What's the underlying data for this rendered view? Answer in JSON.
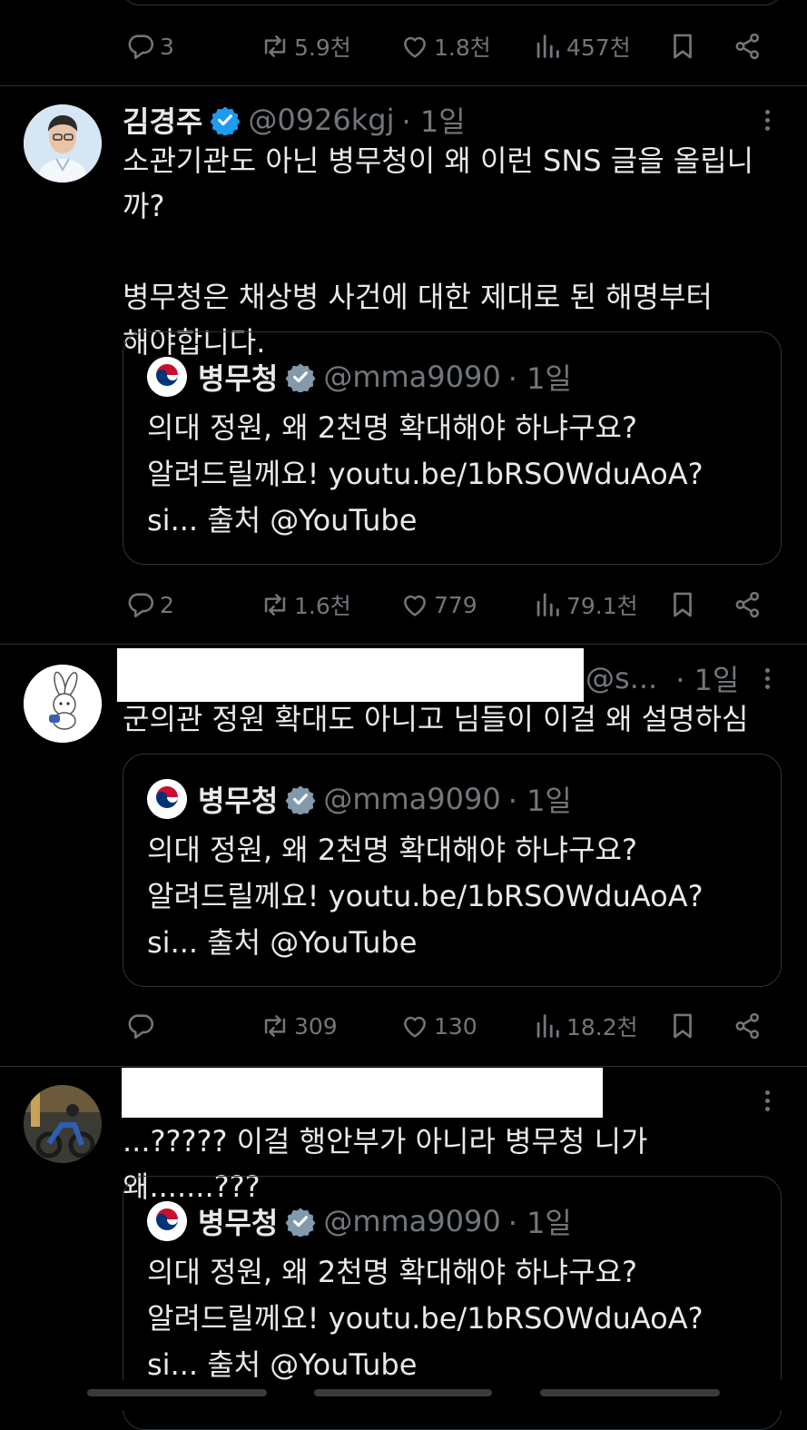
{
  "colors": {
    "background": "#000000",
    "text": "#e7e9ea",
    "muted": "#71767b",
    "verified": "#1d9bf0",
    "divider": "#2f3336"
  },
  "top_actions": {
    "replies": "3",
    "reposts": "5.9천",
    "likes": "1.8천",
    "views": "457천"
  },
  "posts": [
    {
      "name": "김경주",
      "handle": "@0926kgj",
      "time": "· 1일",
      "text": "소관기관도 아닌 병무청이 왜 이런 SNS 글을 올립니까?\n\n병무청은 채상병 사건에 대한 제대로 된 해명부터\n해야합니다.",
      "quote": {
        "name": "병무청",
        "handle": "@mma9090",
        "time": "· 1일",
        "text": "의대 정원, 왜 2천명 확대해야 하냐구요?\n알려드릴께요! youtu.be/1bRSOWduAoA?\nsi... 출처 @YouTube"
      },
      "actions": {
        "replies": "2",
        "reposts": "1.6천",
        "likes": "779",
        "views": "79.1천"
      }
    },
    {
      "handle": "@s...",
      "time": "· 1일",
      "text": "군의관 정원 확대도 아니고 님들이 이걸 왜 설명하심",
      "quote": {
        "name": "병무청",
        "handle": "@mma9090",
        "time": "· 1일",
        "text": "의대 정원, 왜 2천명 확대해야 하냐구요?\n알려드릴께요! youtu.be/1bRSOWduAoA?\nsi... 출처 @YouTube"
      },
      "actions": {
        "replies": "",
        "reposts": "309",
        "likes": "130",
        "views": "18.2천"
      }
    },
    {
      "text": "...????? 이걸 행안부가 아니라 병무청 니가 왜.......???",
      "quote": {
        "name": "병무청",
        "handle": "@mma9090",
        "time": "· 1일",
        "text": "의대 정원, 왜 2천명 확대해야 하냐구요?\n알려드릴께요! youtu.be/1bRSOWduAoA?\nsi... 출처 @YouTube"
      }
    }
  ],
  "icons": [
    "reply-icon",
    "repost-icon",
    "like-icon",
    "views-icon",
    "bookmark-icon",
    "share-icon",
    "verified-icon",
    "more-icon"
  ]
}
